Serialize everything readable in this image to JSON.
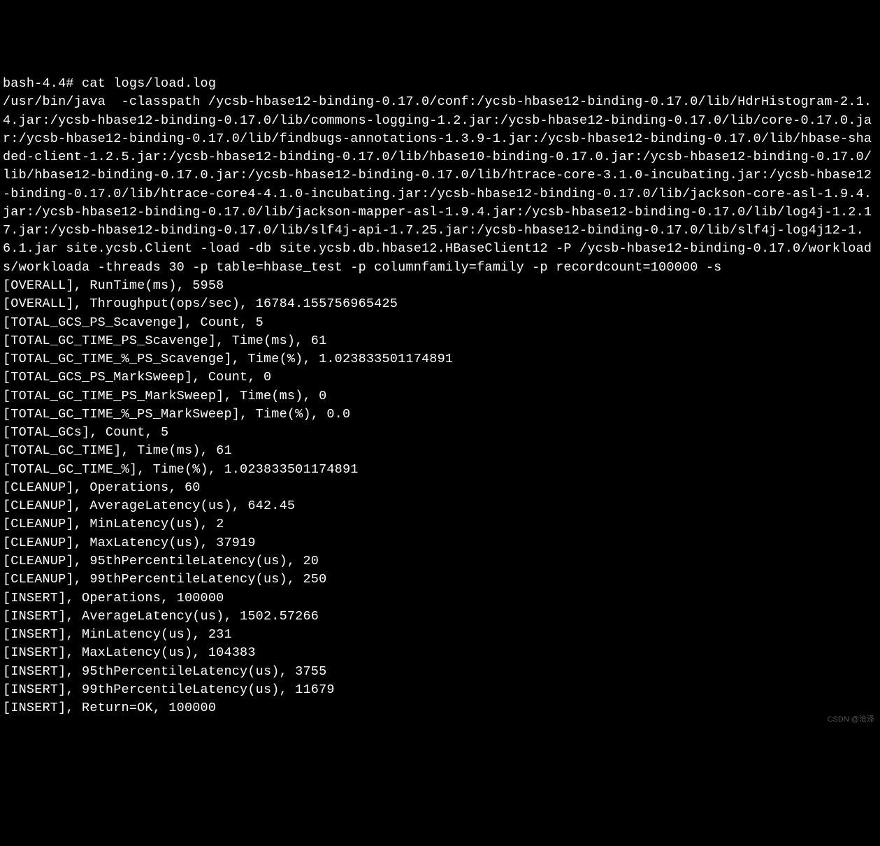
{
  "prompt": "bash-4.4# ",
  "command": "cat logs/load.log",
  "java_command": "/usr/bin/java  -classpath /ycsb-hbase12-binding-0.17.0/conf:/ycsb-hbase12-binding-0.17.0/lib/HdrHistogram-2.1.4.jar:/ycsb-hbase12-binding-0.17.0/lib/commons-logging-1.2.jar:/ycsb-hbase12-binding-0.17.0/lib/core-0.17.0.jar:/ycsb-hbase12-binding-0.17.0/lib/findbugs-annotations-1.3.9-1.jar:/ycsb-hbase12-binding-0.17.0/lib/hbase-shaded-client-1.2.5.jar:/ycsb-hbase12-binding-0.17.0/lib/hbase10-binding-0.17.0.jar:/ycsb-hbase12-binding-0.17.0/lib/hbase12-binding-0.17.0.jar:/ycsb-hbase12-binding-0.17.0/lib/htrace-core-3.1.0-incubating.jar:/ycsb-hbase12-binding-0.17.0/lib/htrace-core4-4.1.0-incubating.jar:/ycsb-hbase12-binding-0.17.0/lib/jackson-core-asl-1.9.4.jar:/ycsb-hbase12-binding-0.17.0/lib/jackson-mapper-asl-1.9.4.jar:/ycsb-hbase12-binding-0.17.0/lib/log4j-1.2.17.jar:/ycsb-hbase12-binding-0.17.0/lib/slf4j-api-1.7.25.jar:/ycsb-hbase12-binding-0.17.0/lib/slf4j-log4j12-1.6.1.jar site.ycsb.Client -load -db site.ycsb.db.hbase12.HBaseClient12 -P /ycsb-hbase12-binding-0.17.0/workloads/workloada -threads 30 -p table=hbase_test -p columnfamily=family -p recordcount=100000 -s",
  "metrics": [
    "[OVERALL], RunTime(ms), 5958",
    "[OVERALL], Throughput(ops/sec), 16784.155756965425",
    "[TOTAL_GCS_PS_Scavenge], Count, 5",
    "[TOTAL_GC_TIME_PS_Scavenge], Time(ms), 61",
    "[TOTAL_GC_TIME_%_PS_Scavenge], Time(%), 1.023833501174891",
    "[TOTAL_GCS_PS_MarkSweep], Count, 0",
    "[TOTAL_GC_TIME_PS_MarkSweep], Time(ms), 0",
    "[TOTAL_GC_TIME_%_PS_MarkSweep], Time(%), 0.0",
    "[TOTAL_GCs], Count, 5",
    "[TOTAL_GC_TIME], Time(ms), 61",
    "[TOTAL_GC_TIME_%], Time(%), 1.023833501174891",
    "[CLEANUP], Operations, 60",
    "[CLEANUP], AverageLatency(us), 642.45",
    "[CLEANUP], MinLatency(us), 2",
    "[CLEANUP], MaxLatency(us), 37919",
    "[CLEANUP], 95thPercentileLatency(us), 20",
    "[CLEANUP], 99thPercentileLatency(us), 250",
    "[INSERT], Operations, 100000",
    "[INSERT], AverageLatency(us), 1502.57266",
    "[INSERT], MinLatency(us), 231",
    "[INSERT], MaxLatency(us), 104383",
    "[INSERT], 95thPercentileLatency(us), 3755",
    "[INSERT], 99thPercentileLatency(us), 11679",
    "[INSERT], Return=OK, 100000"
  ],
  "watermark": "CSDN @沧泽"
}
